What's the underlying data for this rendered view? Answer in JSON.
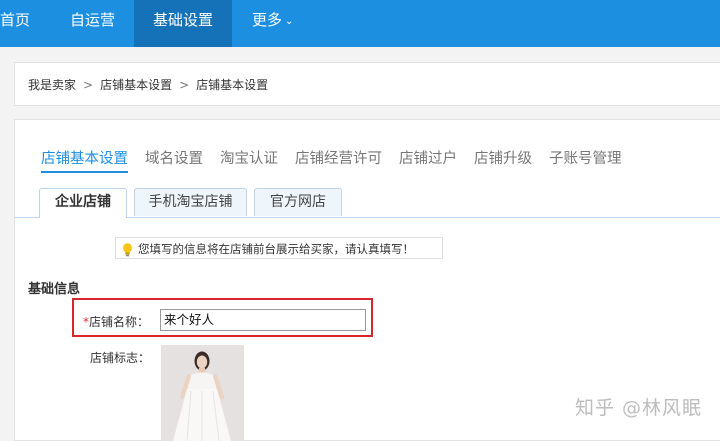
{
  "nav": {
    "items": [
      "首页",
      "自运营",
      "基础设置",
      "更多"
    ],
    "active": "基础设置",
    "more_chevron": "chevron-down-icon"
  },
  "breadcrumb": [
    "我是卖家",
    "店铺基本设置",
    "店铺基本设置"
  ],
  "breadcrumb_separator": ">",
  "tabs_primary": [
    "店铺基本设置",
    "域名设置",
    "淘宝认证",
    "店铺经营许可",
    "店铺过户",
    "店铺升级",
    "子账号管理"
  ],
  "tabs_secondary": [
    "企业店铺",
    "手机淘宝店铺",
    "官方网店"
  ],
  "notice": {
    "icon": "lightbulb-icon",
    "text": "您填写的信息将在店铺前台展示给买家，请认真填写！"
  },
  "section": {
    "title": "基础信息"
  },
  "form": {
    "required_mark": "*",
    "name_label": "店铺名称：",
    "name_value": "来个好人",
    "logo_label": "店铺标志："
  },
  "watermark": "知乎 @林风眠",
  "colors": {
    "nav_bg": "#1d8fe1",
    "nav_active_bg": "#1672b8",
    "tab_active": "#1d8fe1",
    "highlight": "#d9252f"
  }
}
